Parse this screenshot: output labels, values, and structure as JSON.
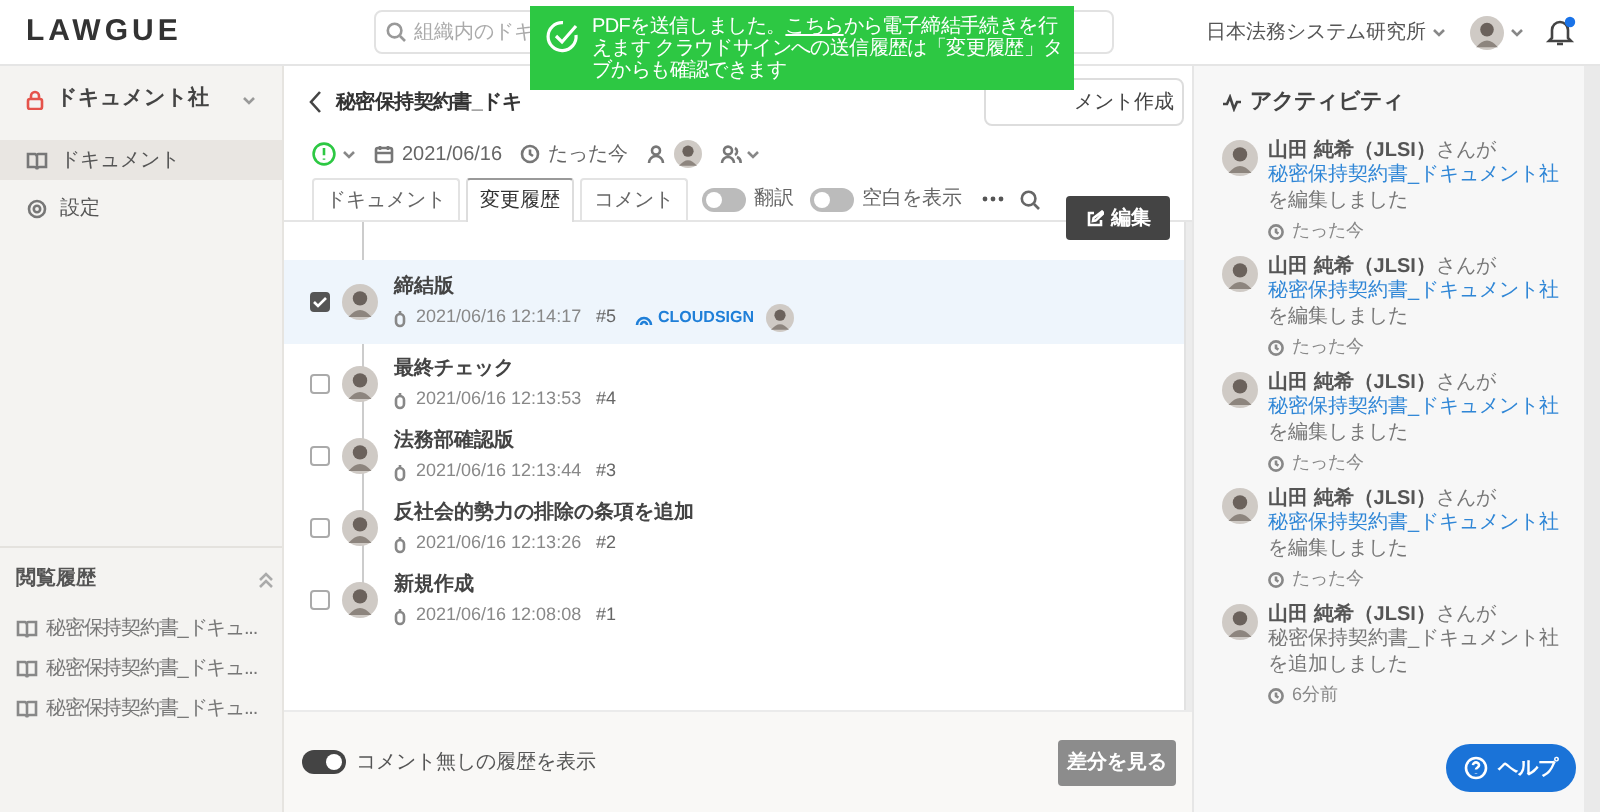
{
  "header": {
    "logo": "LAWGUE",
    "search_placeholder": "組織内のドキ",
    "organization": "日本法務システム研究所",
    "notification_unread": true
  },
  "toast": {
    "before": "PDFを送信しました。",
    "link": "こちら",
    "after": "から電子締結手続きを行えます クラウドサインへの送信履歴は「変更履歴」タブからも確認できます"
  },
  "sidebar": {
    "workspace": "ドキュメント社",
    "nav": [
      {
        "label": "ドキュメント",
        "kind": "book",
        "selected": true
      },
      {
        "label": "設定",
        "kind": "gear",
        "selected": false
      }
    ],
    "history_title": "閲覧履歴",
    "history": [
      "秘密保持契約書_ドキュ...",
      "秘密保持契約書_ドキュ...",
      "秘密保持契約書_ドキュ..."
    ]
  },
  "document": {
    "title": "秘密保持契約書_ドキ",
    "create_button": "メント作成",
    "date": "2021/06/16",
    "updated": "たった今",
    "tabs": [
      {
        "label": "ドキュメント",
        "selected": false
      },
      {
        "label": "変更履歴",
        "selected": true
      },
      {
        "label": "コメント",
        "selected": false
      }
    ],
    "toggles": [
      {
        "label": "翻訳",
        "on": false
      },
      {
        "label": "空白を表示",
        "on": false
      }
    ],
    "edit_button": "編集"
  },
  "versions": [
    {
      "title": "締結版",
      "timestamp": "2021/06/16 12:14:17",
      "number": "#5",
      "selected": true,
      "badge": "CLOUDSIGN"
    },
    {
      "title": "最終チェック",
      "timestamp": "2021/06/16 12:13:53",
      "number": "#4",
      "selected": false
    },
    {
      "title": "法務部確認版",
      "timestamp": "2021/06/16 12:13:44",
      "number": "#3",
      "selected": false
    },
    {
      "title": "反社会的勢力の排除の条項を追加",
      "timestamp": "2021/06/16 12:13:26",
      "number": "#2",
      "selected": false
    },
    {
      "title": "新規作成",
      "timestamp": "2021/06/16 12:08:08",
      "number": "#1",
      "selected": false
    }
  ],
  "footer": {
    "toggle_label": "コメント無しの履歴を表示",
    "toggle_on": true,
    "diff_button": "差分を見る"
  },
  "activity": {
    "title": "アクティビティ",
    "items": [
      {
        "user": "山田 純希（JLSI）",
        "verb": "さんが",
        "target": "秘密保持契約書_ドキュメント社",
        "linked": true,
        "action": "を編集しました",
        "time": "たった今"
      },
      {
        "user": "山田 純希（JLSI）",
        "verb": "さんが",
        "target": "秘密保持契約書_ドキュメント社",
        "linked": true,
        "action": "を編集しました",
        "time": "たった今"
      },
      {
        "user": "山田 純希（JLSI）",
        "verb": "さんが",
        "target": "秘密保持契約書_ドキュメント社",
        "linked": true,
        "action": "を編集しました",
        "time": "たった今"
      },
      {
        "user": "山田 純希（JLSI）",
        "verb": "さんが",
        "target": "秘密保持契約書_ドキュメント社",
        "linked": true,
        "action": "を編集しました",
        "time": "たった今"
      },
      {
        "user": "山田 純希（JLSI）",
        "verb": "さんが",
        "target": "秘密保持契約書_ドキュメント社",
        "linked": false,
        "action": "を追加しました",
        "time": "6分前"
      }
    ]
  },
  "help_button": "ヘルプ"
}
